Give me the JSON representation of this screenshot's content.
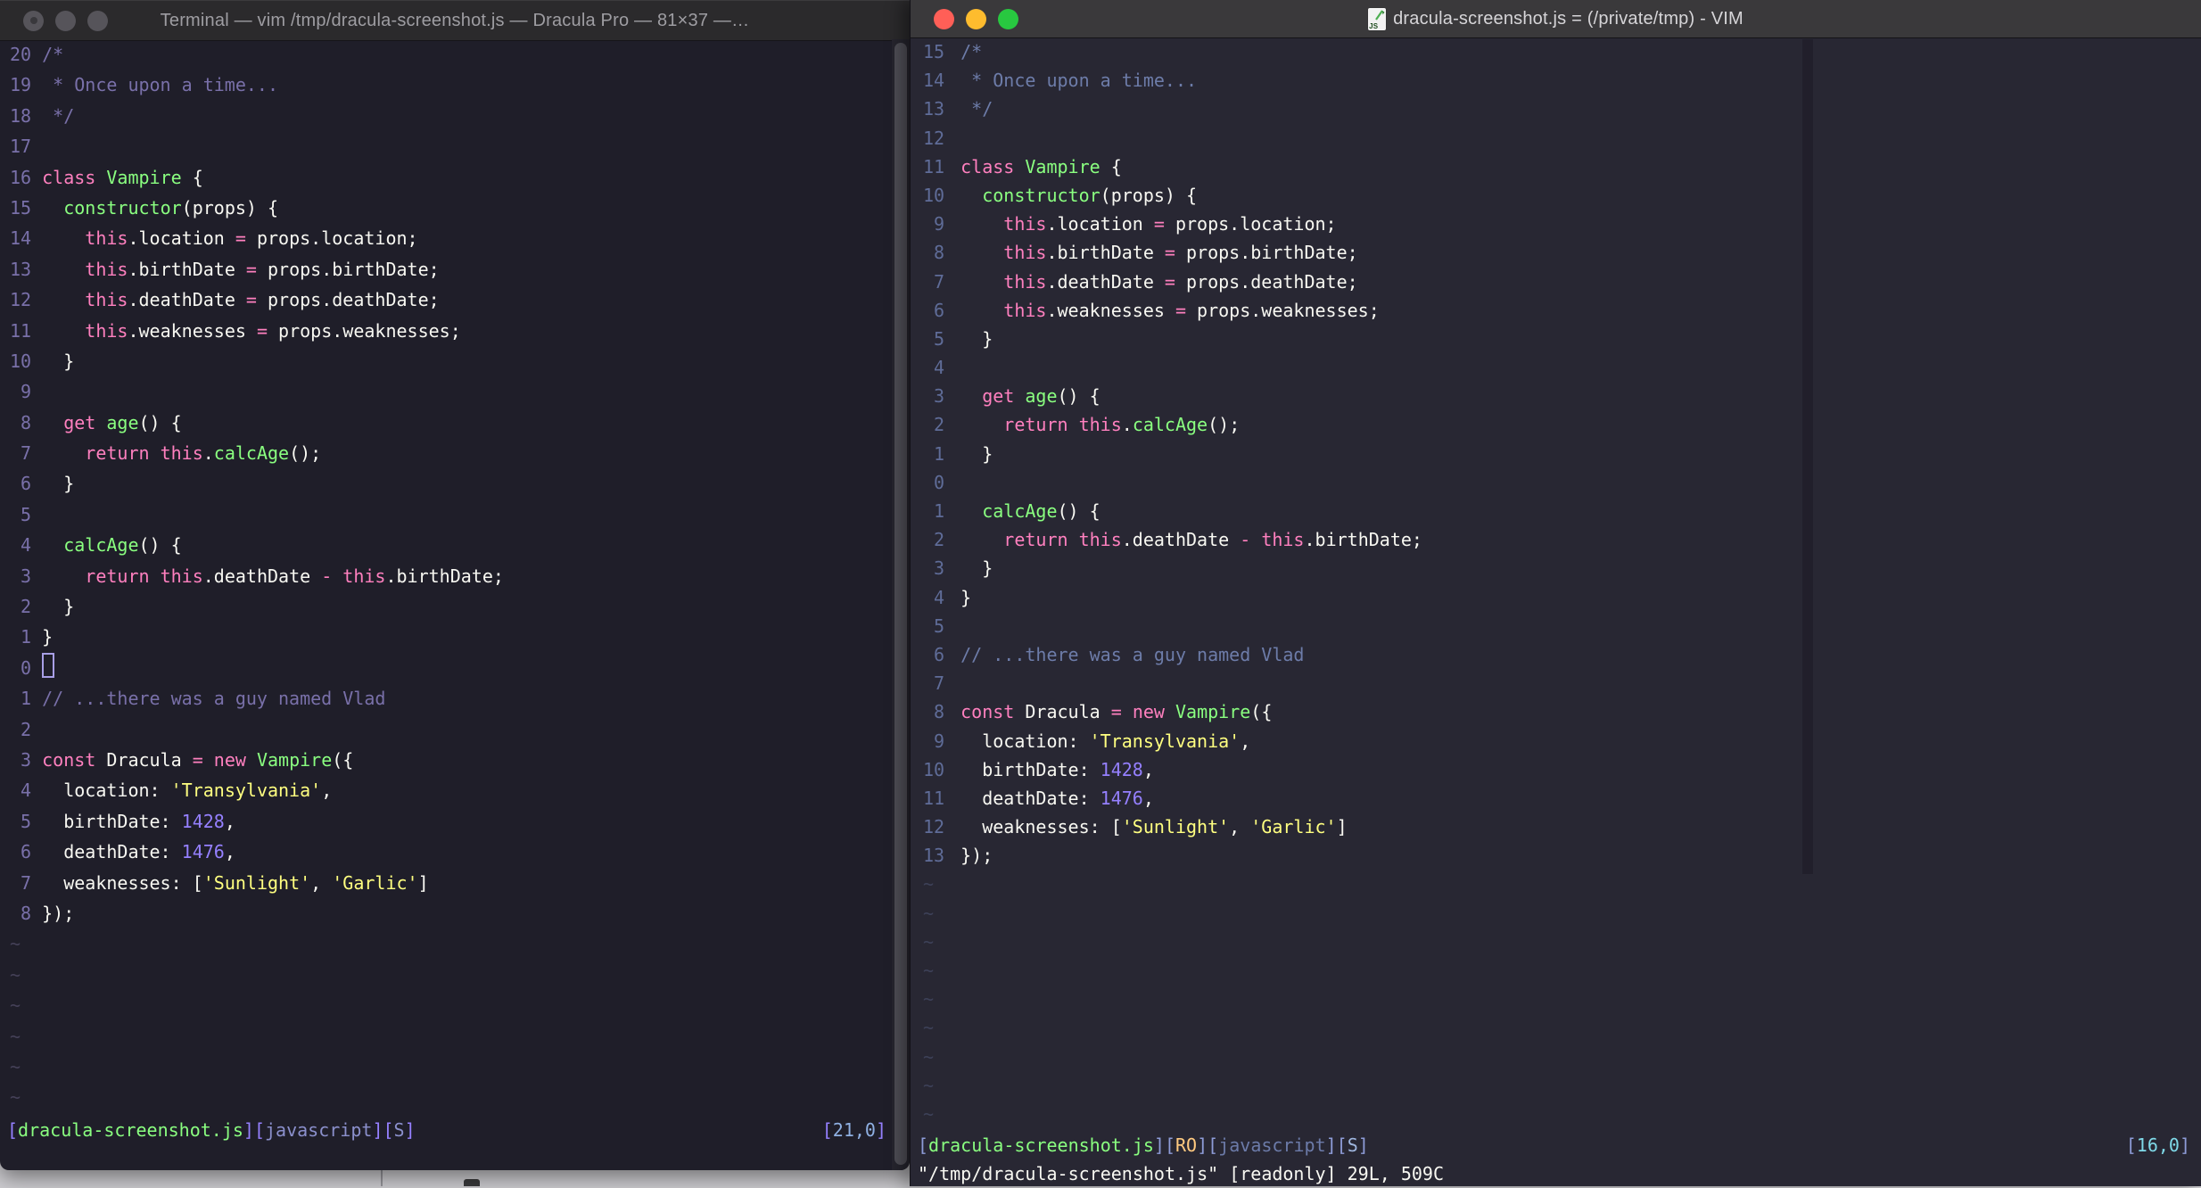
{
  "colors": {
    "fg": "#F8F8F2",
    "pink": "#FF80BF",
    "green": "#8AFF80",
    "yellow": "#FFFF80",
    "purple": "#9580FF",
    "orange": "#FFCA80",
    "left_bg": "#1F1E29",
    "right_bg": "#282733",
    "left_comment": "#7970A9",
    "left_num": "#7970A9",
    "left_tilde": "#454158",
    "right_comment": "#6D7CA9",
    "right_num": "#5F6C98",
    "right_tilde": "#3D4158",
    "bracket_left": "#9580FF",
    "slate_left": "#8B90CC",
    "ruler_num_left": "#8FB0E2",
    "bracket_right": "#8E9CD8",
    "slate_right": "#6C7BA9",
    "flag_right": "#9FB6DF",
    "ruler_num_right": "#7FD9E8",
    "titlebar_inactive_bg": "#2B2A2C",
    "titlebar_active_bg": "#3A393B",
    "title_inactive_fg": "#9E9DA2",
    "title_active_fg": "#D6D5D8",
    "traffic_red": "#FF5F57",
    "traffic_yellow": "#FEBC2E",
    "traffic_green": "#28C840",
    "traffic_inactive": "#56545A",
    "colorcolumn": "#211F2B",
    "scrollbar_thumb": "#4F4E56",
    "desktop": "#CDCCD0"
  },
  "left_window": {
    "title": "Terminal — vim /tmp/dracula-screenshot.js — Dracula Pro — 81×37 —…",
    "numbers": [
      "20",
      "19",
      "18",
      "17",
      "16",
      "15",
      "14",
      "13",
      "12",
      "11",
      "10",
      "9",
      "8",
      "7",
      "6",
      "5",
      "4",
      "3",
      "2",
      "1",
      "0",
      "1",
      "2",
      "3",
      "4",
      "5",
      "6",
      "7",
      "8"
    ],
    "cursor_index": 20,
    "tilde_count": 6,
    "statusline": [
      [
        "[",
        "bracket"
      ],
      [
        "dracula-screenshot.js",
        "file"
      ],
      [
        "][",
        "bracket"
      ],
      [
        "javascript",
        "ft"
      ],
      [
        "][",
        "bracket"
      ],
      [
        "S",
        "flag"
      ],
      [
        "]",
        "bracket"
      ]
    ],
    "ruler": [
      [
        "[",
        "bracket"
      ],
      [
        "21,0",
        "rnum"
      ],
      [
        "]",
        "bracket"
      ]
    ]
  },
  "right_window": {
    "title": "dracula-screenshot.js = (/private/tmp) - VIM",
    "icon_label": "JS",
    "numbers": [
      "15",
      "14",
      "13",
      "12",
      "11",
      "10",
      "9",
      "8",
      "7",
      "6",
      "5",
      "4",
      "3",
      "2",
      "1",
      "0",
      "1",
      "2",
      "3",
      "4",
      "5",
      "6",
      "7",
      "8",
      "9",
      "10",
      "11",
      "12",
      "13"
    ],
    "cursor_index": -1,
    "tilde_count": 9,
    "statusline": [
      [
        "[",
        "bracket"
      ],
      [
        "dracula-screenshot.js",
        "file"
      ],
      [
        "][",
        "bracket"
      ],
      [
        "RO",
        "ro"
      ],
      [
        "][",
        "bracket"
      ],
      [
        "javascript",
        "ft"
      ],
      [
        "][",
        "bracket"
      ],
      [
        "S",
        "flag"
      ],
      [
        "]",
        "bracket"
      ]
    ],
    "ruler": [
      [
        "[",
        "bracket"
      ],
      [
        "16,0",
        "rnum"
      ],
      [
        "]",
        "bracket"
      ]
    ],
    "cmdline": "\"/tmp/dracula-screenshot.js\" [readonly] 29L, 509C"
  },
  "code_lines": [
    {
      "s": [
        [
          "/*",
          "comment"
        ]
      ]
    },
    {
      "s": [
        [
          " * Once upon a time...",
          "comment"
        ]
      ]
    },
    {
      "s": [
        [
          " */",
          "comment"
        ]
      ]
    },
    {
      "s": []
    },
    {
      "s": [
        [
          "class",
          "pink"
        ],
        [
          " ",
          "fg"
        ],
        [
          "Vampire",
          "green"
        ],
        [
          " {",
          "fg"
        ]
      ]
    },
    {
      "s": [
        [
          "  ",
          "fg"
        ],
        [
          "constructor",
          "green"
        ],
        [
          "(props) {",
          "fg"
        ]
      ]
    },
    {
      "s": [
        [
          "    ",
          "fg"
        ],
        [
          "this",
          "pink"
        ],
        [
          ".location ",
          "fg"
        ],
        [
          "=",
          "pink"
        ],
        [
          " props.location;",
          "fg"
        ]
      ]
    },
    {
      "s": [
        [
          "    ",
          "fg"
        ],
        [
          "this",
          "pink"
        ],
        [
          ".birthDate ",
          "fg"
        ],
        [
          "=",
          "pink"
        ],
        [
          " props.birthDate;",
          "fg"
        ]
      ]
    },
    {
      "s": [
        [
          "    ",
          "fg"
        ],
        [
          "this",
          "pink"
        ],
        [
          ".deathDate ",
          "fg"
        ],
        [
          "=",
          "pink"
        ],
        [
          " props.deathDate;",
          "fg"
        ]
      ]
    },
    {
      "s": [
        [
          "    ",
          "fg"
        ],
        [
          "this",
          "pink"
        ],
        [
          ".weaknesses ",
          "fg"
        ],
        [
          "=",
          "pink"
        ],
        [
          " props.weaknesses;",
          "fg"
        ]
      ]
    },
    {
      "s": [
        [
          "  }",
          "fg"
        ]
      ]
    },
    {
      "s": []
    },
    {
      "s": [
        [
          "  ",
          "fg"
        ],
        [
          "get",
          "pink"
        ],
        [
          " ",
          "fg"
        ],
        [
          "age",
          "green"
        ],
        [
          "() {",
          "fg"
        ]
      ]
    },
    {
      "s": [
        [
          "    ",
          "fg"
        ],
        [
          "return",
          "pink"
        ],
        [
          " ",
          "fg"
        ],
        [
          "this",
          "pink"
        ],
        [
          ".",
          "fg"
        ],
        [
          "calcAge",
          "green"
        ],
        [
          "();",
          "fg"
        ]
      ]
    },
    {
      "s": [
        [
          "  }",
          "fg"
        ]
      ]
    },
    {
      "s": []
    },
    {
      "s": [
        [
          "  ",
          "fg"
        ],
        [
          "calcAge",
          "green"
        ],
        [
          "() {",
          "fg"
        ]
      ]
    },
    {
      "s": [
        [
          "    ",
          "fg"
        ],
        [
          "return",
          "pink"
        ],
        [
          " ",
          "fg"
        ],
        [
          "this",
          "pink"
        ],
        [
          ".deathDate ",
          "fg"
        ],
        [
          "-",
          "pink"
        ],
        [
          " ",
          "fg"
        ],
        [
          "this",
          "pink"
        ],
        [
          ".birthDate;",
          "fg"
        ]
      ]
    },
    {
      "s": [
        [
          "  }",
          "fg"
        ]
      ]
    },
    {
      "s": [
        [
          "}",
          "fg"
        ]
      ]
    },
    {
      "s": []
    },
    {
      "s": [
        [
          "// ...there was a guy named Vlad",
          "comment"
        ]
      ]
    },
    {
      "s": []
    },
    {
      "s": [
        [
          "const",
          "pink"
        ],
        [
          " Dracula ",
          "fg"
        ],
        [
          "=",
          "pink"
        ],
        [
          " ",
          "fg"
        ],
        [
          "new",
          "pink"
        ],
        [
          " ",
          "fg"
        ],
        [
          "Vampire",
          "green"
        ],
        [
          "({",
          "fg"
        ]
      ]
    },
    {
      "s": [
        [
          "  location: ",
          "fg"
        ],
        [
          "'Transylvania'",
          "yellow"
        ],
        [
          ",",
          "fg"
        ]
      ]
    },
    {
      "s": [
        [
          "  birthDate: ",
          "fg"
        ],
        [
          "1428",
          "purple"
        ],
        [
          ",",
          "fg"
        ]
      ]
    },
    {
      "s": [
        [
          "  deathDate: ",
          "fg"
        ],
        [
          "1476",
          "purple"
        ],
        [
          ",",
          "fg"
        ]
      ]
    },
    {
      "s": [
        [
          "  weaknesses: [",
          "fg"
        ],
        [
          "'Sunlight'",
          "yellow"
        ],
        [
          ", ",
          "fg"
        ],
        [
          "'Garlic'",
          "yellow"
        ],
        [
          "]",
          "fg"
        ]
      ]
    },
    {
      "s": [
        [
          "});",
          "fg"
        ]
      ]
    }
  ]
}
